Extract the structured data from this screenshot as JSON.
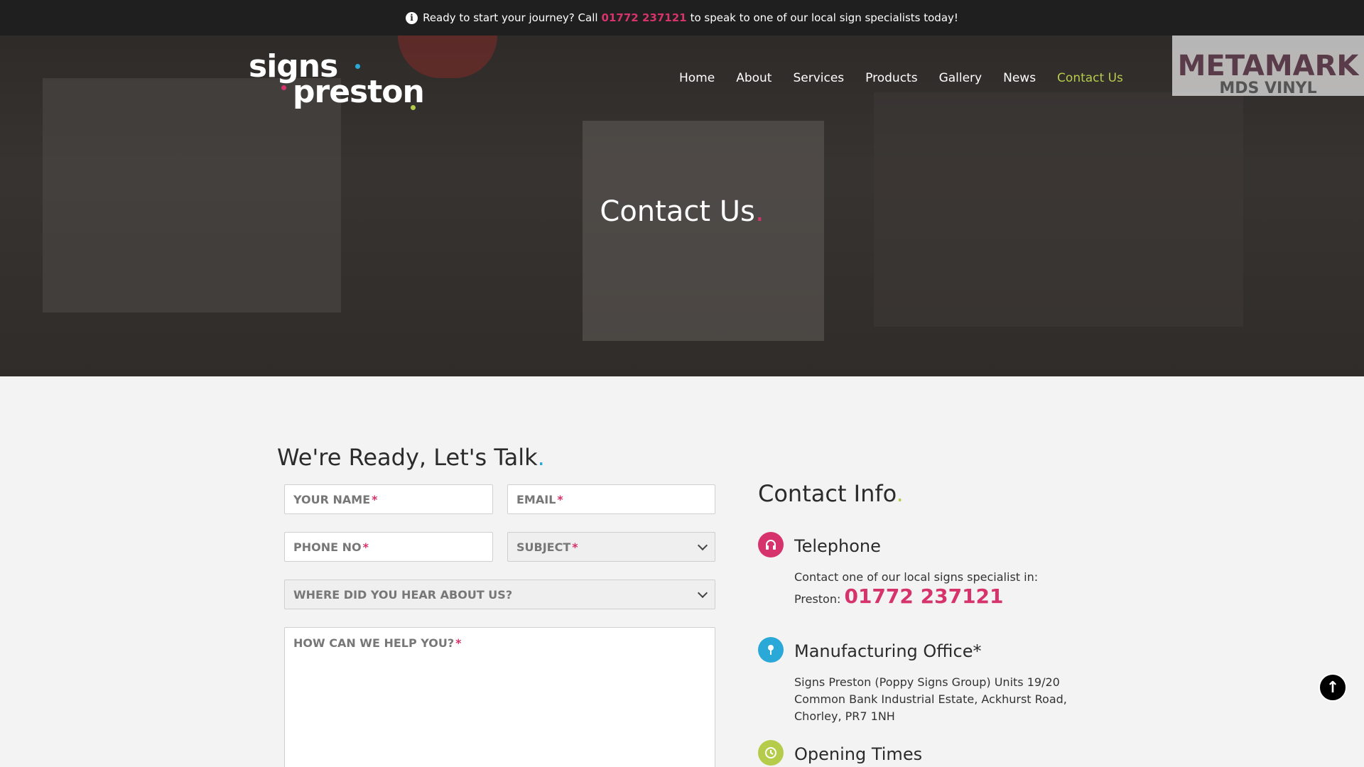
{
  "topbar": {
    "text_before": "Ready to start your journey? Call",
    "phone": "01772 237121",
    "text_after": "to speak to one of our local sign specialists today!"
  },
  "logo": {
    "line1": "signs",
    "line2": "preston"
  },
  "nav": {
    "items": [
      {
        "label": "Home"
      },
      {
        "label": "About"
      },
      {
        "label": "Services"
      },
      {
        "label": "Products"
      },
      {
        "label": "Gallery"
      },
      {
        "label": "News"
      },
      {
        "label": "Contact Us",
        "active": true
      }
    ]
  },
  "hero": {
    "title": "Contact Us",
    "banner_line1": "METAMARK",
    "banner_line2": "MDS VINYL"
  },
  "form": {
    "title": "We're Ready, Let's Talk",
    "name_placeholder": "YOUR NAME",
    "email_placeholder": "EMAIL",
    "phone_placeholder": "PHONE NO",
    "subject_placeholder": "SUBJECT",
    "source_placeholder": "WHERE DID YOU HEAR ABOUT US?",
    "message_placeholder": "HOW CAN WE HELP YOU?",
    "required_mark": "*"
  },
  "contact_info": {
    "title": "Contact Info",
    "telephone": {
      "heading": "Telephone",
      "text": "Contact one of our local signs specialist in:",
      "location_label": "Preston:",
      "number": "01772 237121"
    },
    "office": {
      "heading": "Manufacturing Office*",
      "line1": "Signs Preston (Poppy Signs Group) Units 19/20",
      "line2": "Common Bank Industrial Estate, Ackhurst Road,",
      "line3": "Chorley, PR7 1NH"
    },
    "hours": {
      "heading": "Opening Times"
    }
  },
  "colors": {
    "accent_pink": "#d6336c",
    "accent_blue": "#2aa8d8",
    "accent_green": "#b5cc4b",
    "topbar_bg": "#1f1f1f"
  },
  "icons": {
    "info": "info-icon",
    "telephone": "headphones-icon",
    "office": "map-pin-icon",
    "hours": "clock-icon",
    "scroll_top": "arrow-up-icon"
  }
}
